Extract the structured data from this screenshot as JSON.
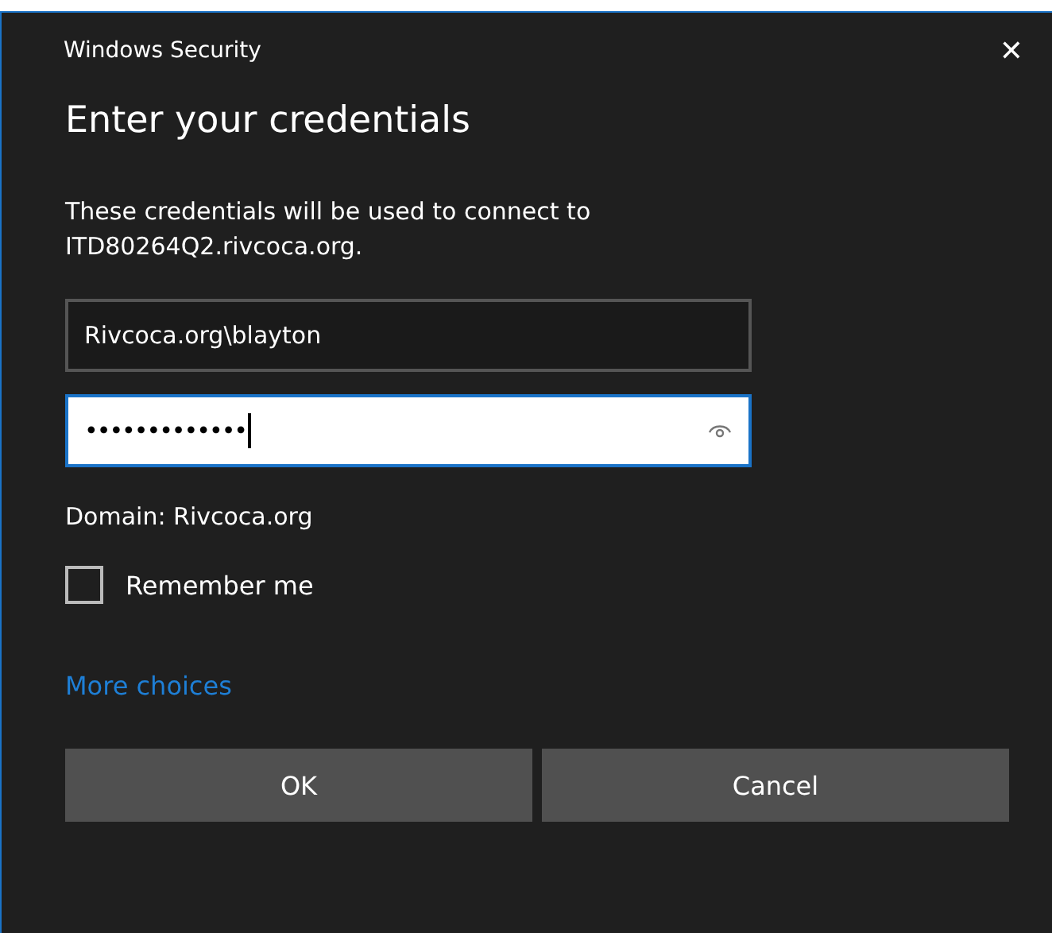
{
  "window": {
    "title": "Windows Security",
    "close": "✕"
  },
  "heading": "Enter your credentials",
  "message": "These credentials will be used to connect to ITD80264Q2.rivcoca.org.",
  "fields": [
    {
      "kind": "text",
      "value": "Rivcoca.org\\blayton",
      "focused": false
    },
    {
      "kind": "password",
      "value": "•••••••••••••",
      "focused": true
    }
  ],
  "domain": "Domain: Rivcoca.org",
  "remember": {
    "label": "Remember me",
    "checked": false
  },
  "more_choices": "More choices",
  "buttons": [
    "OK",
    "Cancel"
  ]
}
